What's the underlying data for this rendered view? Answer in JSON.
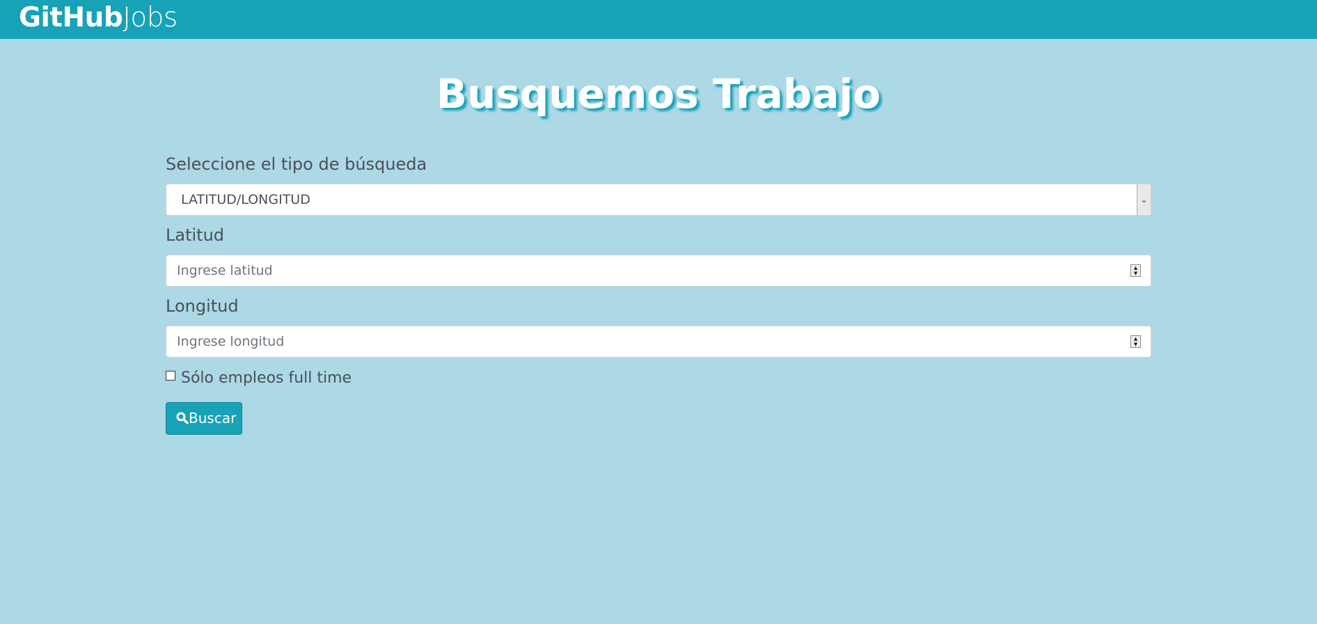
{
  "navbar": {
    "brand_bold": "GitHub",
    "brand_light": "Jobs",
    "background": "#17a2b8"
  },
  "page": {
    "title": "Busquemos Trabajo",
    "background": "#add8e6"
  },
  "form": {
    "search_type": {
      "label": "Seleccione el tipo de búsqueda",
      "selected": "LATITUD/LONGITUD"
    },
    "latitude": {
      "label": "Latitud",
      "placeholder": "Ingrese latitud"
    },
    "longitude": {
      "label": "Longitud",
      "placeholder": "Ingrese longitud"
    },
    "fulltime": {
      "label": "Sólo empleos full time",
      "checked": false
    },
    "submit": {
      "label": "Buscar",
      "icon": "search-icon"
    }
  }
}
